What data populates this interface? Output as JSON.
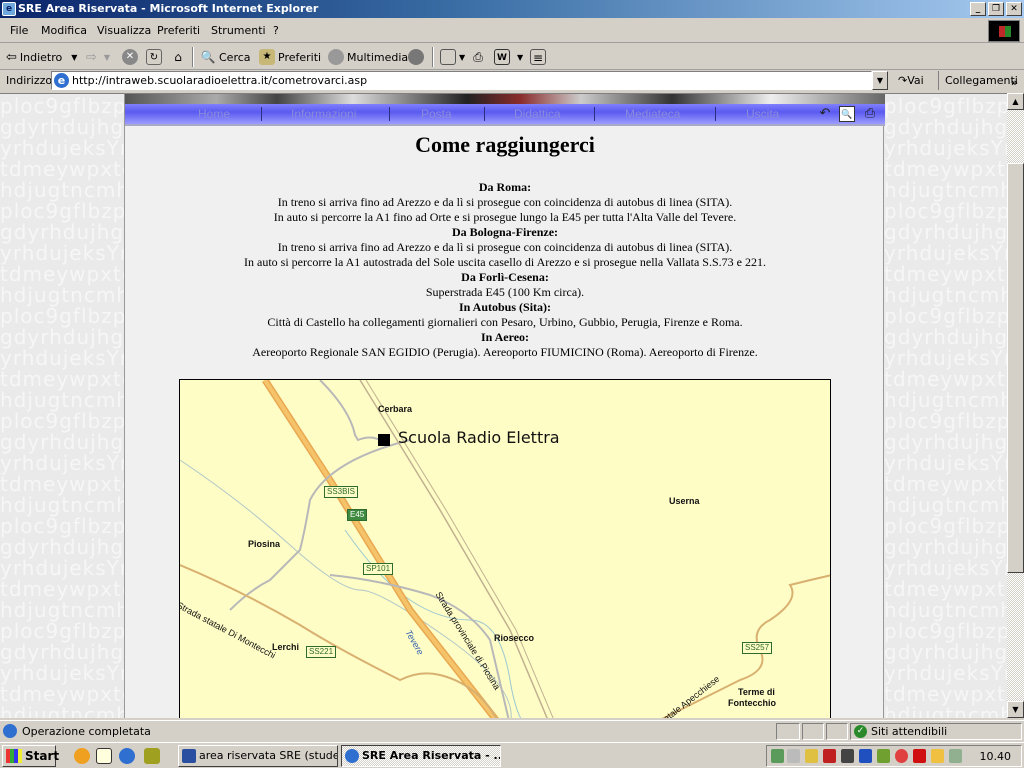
{
  "window": {
    "title": "SRE Area Riservata - Microsoft Internet Explorer",
    "buttons": [
      "_",
      "❐",
      "✕"
    ]
  },
  "menu": [
    "File",
    "Modifica",
    "Visualizza",
    "Preferiti",
    "Strumenti",
    "?"
  ],
  "toolbar": {
    "back": "Indietro",
    "search": "Cerca",
    "favorites": "Preferiti",
    "media": "Multimedia"
  },
  "address": {
    "label": "Indirizzo",
    "url": "http://intraweb.scuolaradioelettra.it/cometrovarci.asp",
    "go": "Vai",
    "links": "Collegamenti"
  },
  "background_text": "ploc9gflbzpioc9\ngdyrhdujhgdyrhd\nyrhdujeksYrhduj\ntdmeywpxtdmeywp\nhdjugtncmhdjugt\nploc9gflbzpioc9\ngdyrhdujhgdyrhd\nyrhdujeksYrhduj\ntdmeywpxtdmeywp\nhdjugtncmhdjugt\nploc9gflbzpioc9\ngdyrhdujhgdyrhd\nyrhdujeksYrhduj\ntdmeywpxtdmeywp\nhdjugtncmhdjugt\nploc9gflbzpioc9\ngdyrhdujhgdyrhd\nyrhdujeksYrhduj\ntdmeywpxtdmeywp\nhdjugtncmhdjugt\nploc9gflbzpioc9\ngdyrhdujhgdyrhd\nyrhdujeksYrhduj\ntdmeywpxtdmeywp\nhdjugtncmhdjugt\nploc9gflbzpioc9\ngdyrhdujhgdyrhd\nyrhdujeksYrhduj\ntdmeywpxtdmeywp\nhdjugtncmhdjugt",
  "nav": {
    "items": [
      "Home",
      "Informazioni",
      "Posta",
      "Didattica",
      "Mediateca",
      "Uscita"
    ],
    "icons": [
      "undo-icon",
      "print-preview-icon",
      "print-icon"
    ]
  },
  "page": {
    "title": "Come raggiungerci",
    "sections": [
      {
        "heading": "Da Roma:",
        "lines": [
          "In treno si arriva fino ad Arezzo e da lì si prosegue con coincidenza di autobus di linea (SITA).",
          "In auto si percorre la A1 fino ad Orte e si prosegue lungo la E45 per tutta l'Alta Valle del Tevere."
        ]
      },
      {
        "heading": "Da Bologna-Firenze:",
        "lines": [
          "In treno si arriva fino ad Arezzo e da lì si prosegue con coincidenza di autobus di linea (SITA).",
          "In auto si percorre la A1 autostrada del Sole uscita casello di Arezzo e si prosegue nella Vallata S.S.73 e 221."
        ]
      },
      {
        "heading": "Da Forlì-Cesena:",
        "lines": [
          "Superstrada E45 (100 Km circa)."
        ]
      },
      {
        "heading": "In Autobus (Sita):",
        "lines": [
          "Città di Castello ha collegamenti giornalieri con Pesaro, Urbino, Gubbio, Perugia, Firenze e Roma."
        ]
      },
      {
        "heading": "In Aereo:",
        "lines": [
          "Aereoporto Regionale SAN EGIDIO (Perugia). Aereoporto FIUMICINO (Roma). Aereoporto di Firenze."
        ]
      }
    ]
  },
  "map": {
    "school_label": "Scuola Radio Elettra",
    "places": [
      "Cerbara",
      "Userna",
      "Piosina",
      "Riosecco",
      "Lerchi",
      "Terme di",
      "Fontecchio"
    ],
    "road_tags": [
      "SS3BIS",
      "E45",
      "SP101",
      "SS221",
      "SS257"
    ],
    "road_names": [
      "Strada statale Di Montecchi",
      "Strada provinciale di Piosina",
      "statale Apecchiese"
    ],
    "river": "Tevere"
  },
  "status": {
    "text": "Operazione completata",
    "zone": "Siti attendibili"
  },
  "taskbar": {
    "start": "Start",
    "tasks": [
      "area riservata SRE (stude...",
      "SRE Area Riservata - ..."
    ],
    "clock": "10.40"
  }
}
